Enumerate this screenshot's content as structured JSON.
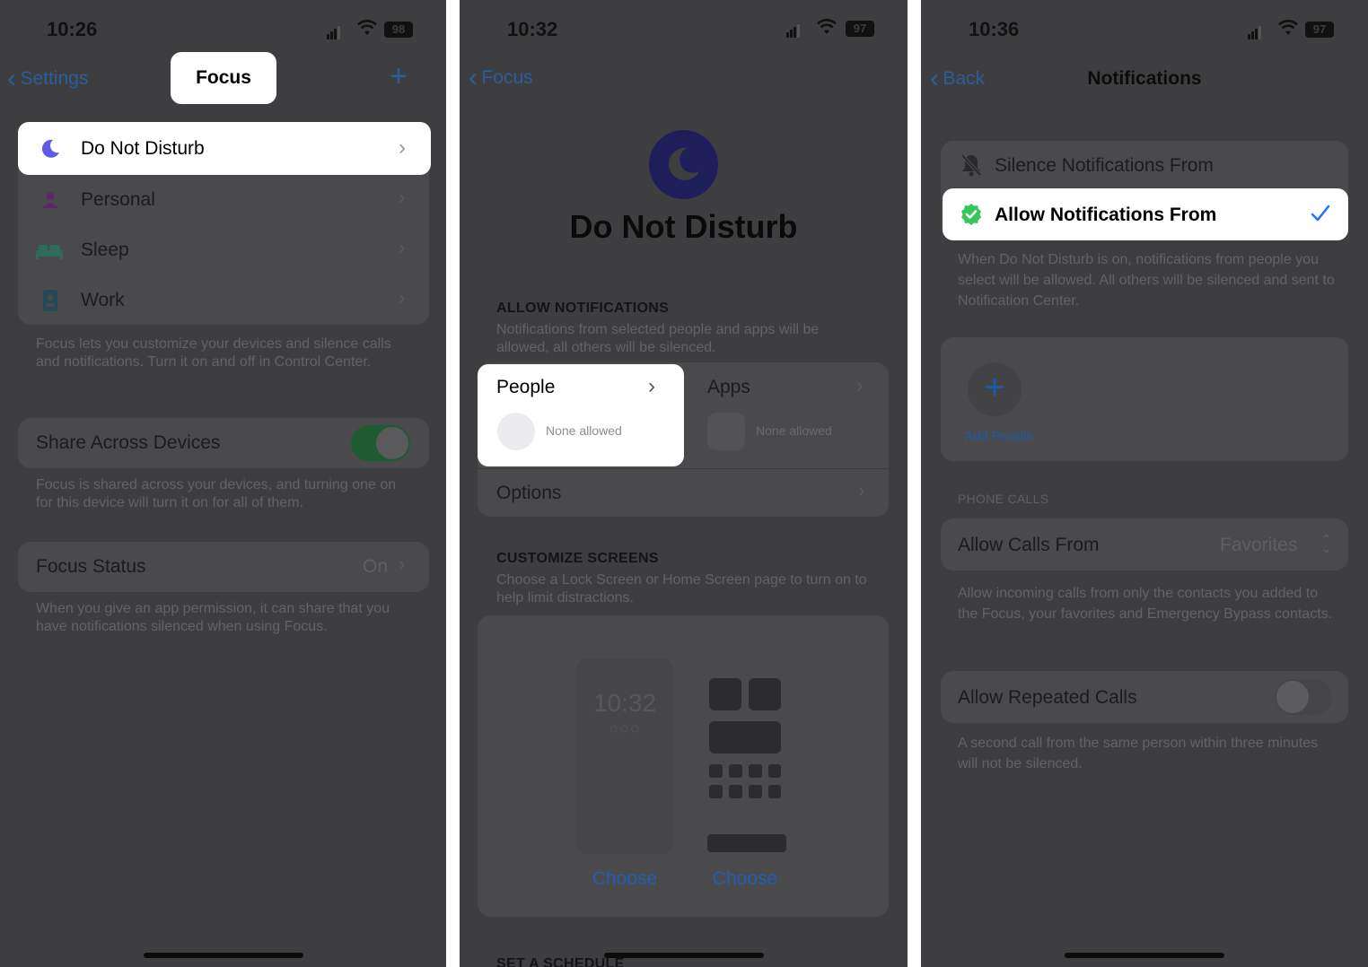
{
  "screen1": {
    "time": "10:26",
    "battery": "98",
    "back_label": "Settings",
    "title": "Focus",
    "add_icon": "plus-icon",
    "modes": [
      {
        "label": "Do Not Disturb",
        "icon": "moon-icon"
      },
      {
        "label": "Personal",
        "icon": "person-icon"
      },
      {
        "label": "Sleep",
        "icon": "bed-icon"
      },
      {
        "label": "Work",
        "icon": "id-badge-icon"
      }
    ],
    "modes_footer": "Focus lets you customize your devices and silence calls and notifications. Turn it on and off in Control Center.",
    "share_label": "Share Across Devices",
    "share_on": true,
    "share_footer": "Focus is shared across your devices, and turning one on for this device will turn it on for all of them.",
    "status_label": "Focus Status",
    "status_value": "On",
    "status_footer": "When you give an app permission, it can share that you have notifications silenced when using Focus."
  },
  "screen2": {
    "time": "10:32",
    "battery": "97",
    "back_label": "Focus",
    "title": "Do Not Disturb",
    "allow_header": "ALLOW NOTIFICATIONS",
    "allow_desc": "Notifications from selected people and apps will be allowed, all others will be silenced.",
    "people_label": "People",
    "people_value": "None allowed",
    "apps_label": "Apps",
    "apps_value": "None allowed",
    "options_label": "Options",
    "customize_header": "CUSTOMIZE SCREENS",
    "customize_desc": "Choose a Lock Screen or Home Screen page to turn on to help limit distractions.",
    "lock_preview_time": "10:32",
    "choose_lock": "Choose",
    "choose_home": "Choose",
    "schedule_header": "SET A SCHEDULE"
  },
  "screen3": {
    "time": "10:36",
    "battery": "97",
    "back_label": "Back",
    "title": "Notifications",
    "silence_label": "Silence Notifications From",
    "allow_label": "Allow Notifications From",
    "allow_desc": "When Do Not Disturb is on, notifications from people you select will be allowed. All others will be silenced and sent to Notification Center.",
    "add_people": "Add People",
    "phone_calls_header": "PHONE CALLS",
    "calls_from_label": "Allow Calls From",
    "calls_from_value": "Favorites",
    "calls_desc": "Allow incoming calls from only the contacts you added to the Focus, your favorites and Emergency Bypass contacts.",
    "repeated_label": "Allow Repeated Calls",
    "repeated_on": false,
    "repeated_desc": "A second call from the same person within three minutes will not be silenced."
  },
  "colors": {
    "dim_background": "#3e3e40",
    "highlight": "#ffffff",
    "accent_blue": "#1f77ff",
    "moon_purple": "#5e5ce6",
    "toggle_green": "#1e5b32",
    "check_green": "#34c759"
  }
}
